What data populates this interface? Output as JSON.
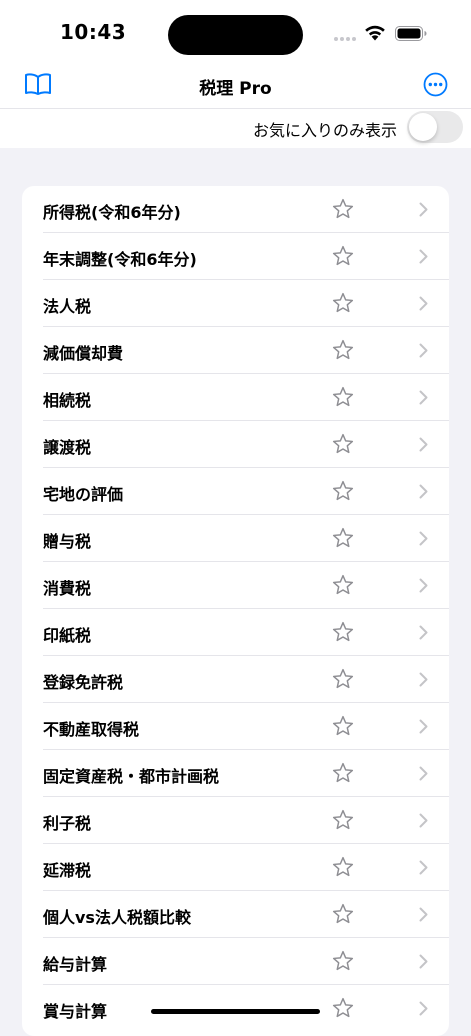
{
  "status_bar": {
    "time": "10:43"
  },
  "nav": {
    "title": "税理 Pro",
    "left_icon": "book-icon",
    "right_icon": "ellipsis-circle-icon",
    "accent_color": "#007aff"
  },
  "filter": {
    "label": "お気に入りのみ表示",
    "favorites_only": false
  },
  "items": [
    {
      "label": "所得税(令和6年分)",
      "favorite": false
    },
    {
      "label": "年末調整(令和6年分)",
      "favorite": false
    },
    {
      "label": "法人税",
      "favorite": false
    },
    {
      "label": "減価償却費",
      "favorite": false
    },
    {
      "label": "相続税",
      "favorite": false
    },
    {
      "label": "譲渡税",
      "favorite": false
    },
    {
      "label": "宅地の評価",
      "favorite": false
    },
    {
      "label": "贈与税",
      "favorite": false
    },
    {
      "label": "消費税",
      "favorite": false
    },
    {
      "label": "印紙税",
      "favorite": false
    },
    {
      "label": "登録免許税",
      "favorite": false
    },
    {
      "label": "不動産取得税",
      "favorite": false
    },
    {
      "label": "固定資産税・都市計画税",
      "favorite": false
    },
    {
      "label": "利子税",
      "favorite": false
    },
    {
      "label": "延滞税",
      "favorite": false
    },
    {
      "label": "個人vs法人税額比較",
      "favorite": false
    },
    {
      "label": "給与計算",
      "favorite": false
    },
    {
      "label": "賞与計算",
      "favorite": false
    }
  ]
}
